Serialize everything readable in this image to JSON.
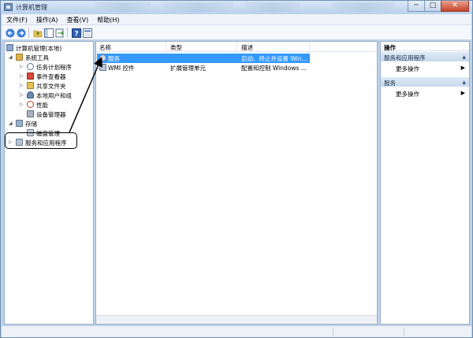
{
  "window": {
    "title": "计算机管理",
    "buttons": {
      "minimize": "─",
      "maximize": "□",
      "close": "✕"
    }
  },
  "menubar": [
    "文件(F)",
    "操作(A)",
    "查看(V)",
    "帮助(H)"
  ],
  "tree": {
    "root": "计算机管理(本地)",
    "system_tools": "系统工具",
    "task_scheduler": "任务计划程序",
    "event_viewer": "事件查看器",
    "shared_folders": "共享文件夹",
    "local_users": "本地用户和组",
    "performance": "性能",
    "device_manager": "设备管理器",
    "storage": "存储",
    "disk_management": "磁盘管理",
    "services_apps": "服务和应用程序"
  },
  "list": {
    "headers": {
      "name": "名称",
      "type": "类型",
      "desc": "描述"
    },
    "rows": [
      {
        "name": "服务",
        "type": "",
        "desc": "启动、终止并设置 Win..."
      },
      {
        "name": "WMI 控件",
        "type": "扩展管理单元",
        "desc": "配置和控制 Windows ..."
      }
    ]
  },
  "actions": {
    "title": "操作",
    "section1": "服务和应用程序",
    "more1": "更多操作",
    "section2": "服务",
    "more2": "更多操作"
  },
  "colors": {
    "selection": "#3399ff",
    "frame": "#bcd3ea"
  }
}
